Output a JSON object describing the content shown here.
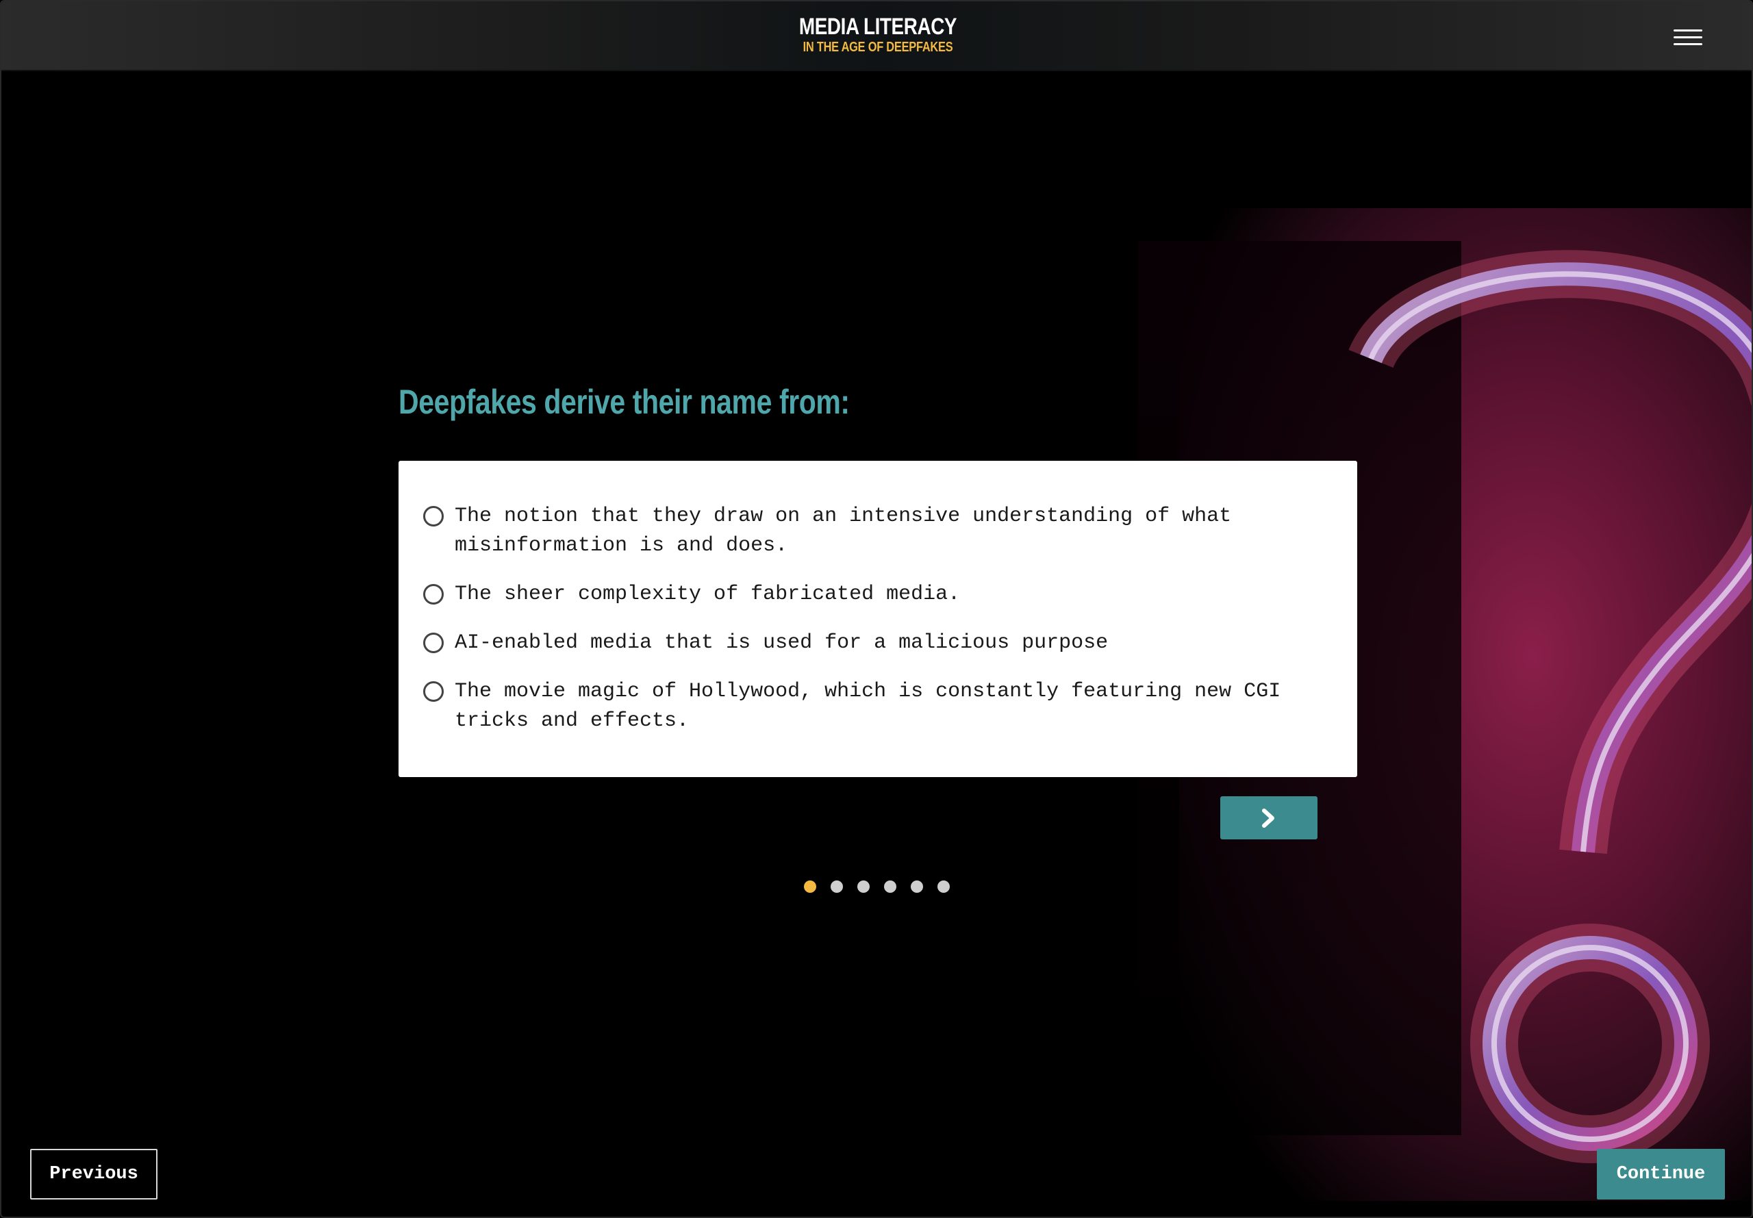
{
  "header": {
    "title": "MEDIA LITERACY",
    "subtitle": "IN THE AGE OF DEEPFAKES",
    "menu_icon": "hamburger-menu-icon"
  },
  "quiz": {
    "question": "Deepfakes derive their name from:",
    "options": [
      {
        "label": "The notion that they draw on an intensive understanding of what misinformation is and does."
      },
      {
        "label": "The sheer complexity of fabricated media."
      },
      {
        "label": "AI-enabled media that is used for a malicious purpose"
      },
      {
        "label": "The movie magic of Hollywood, which is constantly featuring new CGI tricks and effects."
      }
    ],
    "next_icon": "chevron-right-icon",
    "pagination": {
      "total": 6,
      "current": 1
    }
  },
  "footer": {
    "previous_label": "Previous",
    "continue_label": "Continue"
  },
  "colors": {
    "accent": "#4fa7ab",
    "button": "#3c8b8e",
    "highlight": "#f4b942"
  }
}
